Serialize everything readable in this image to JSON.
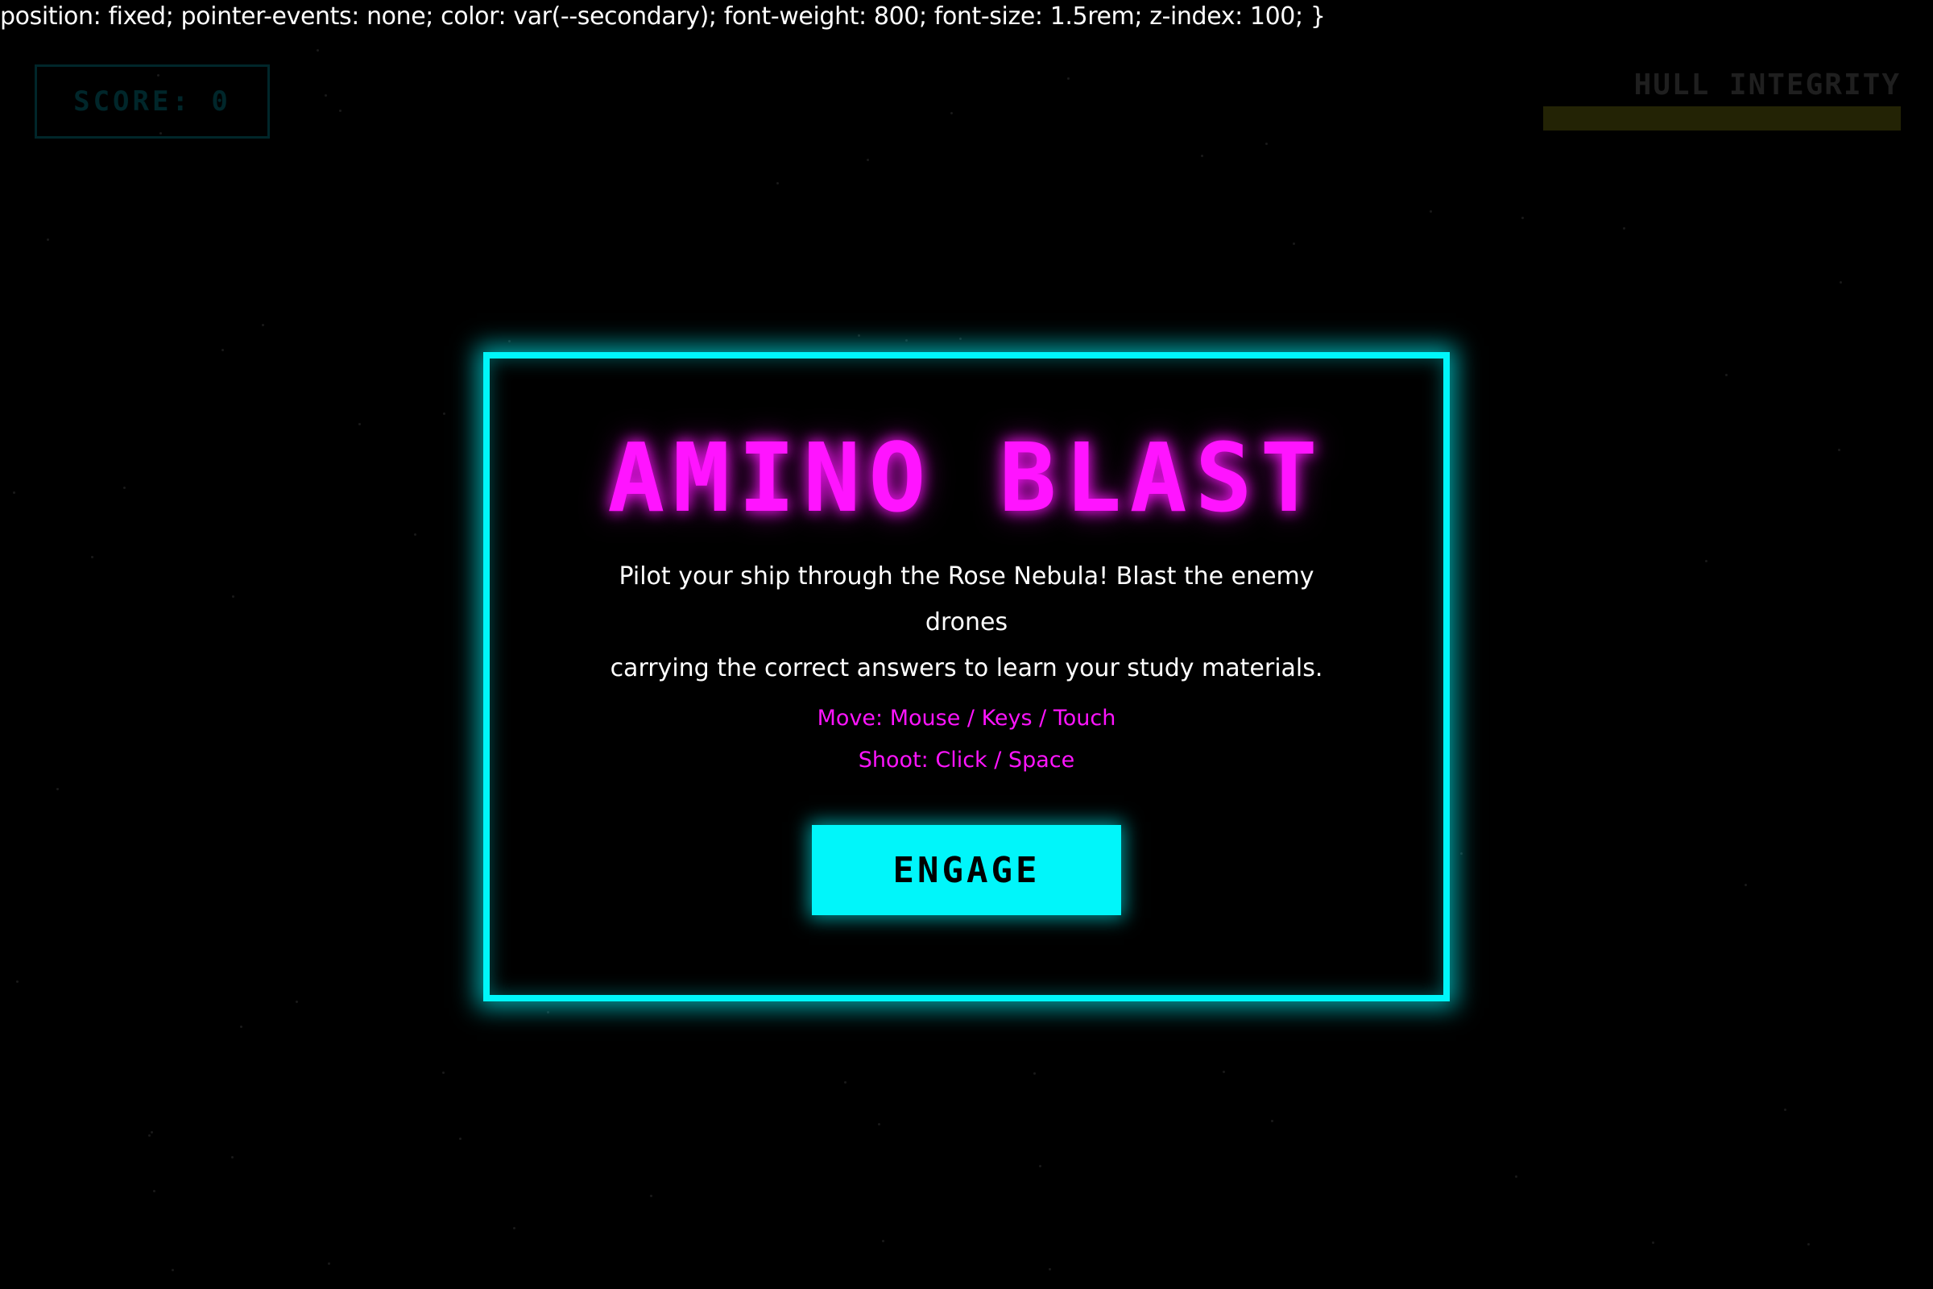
{
  "debug_css_text": "position: fixed; pointer-events: none; color: var(--secondary); font-weight: 800; font-size: 1.5rem; z-index: 100; }",
  "hud": {
    "score_label": "SCORE: 0",
    "hull_label": "HULL INTEGRITY",
    "hull_level_percent": 100
  },
  "modal": {
    "title": "AMINO BLAST",
    "description_line1": "Pilot your ship through the Rose Nebula! Blast the enemy drones",
    "description_line2": "carrying the correct answers to learn your study materials.",
    "controls_move": "Move: Mouse / Keys / Touch",
    "controls_shoot": "Shoot: Click / Space",
    "engage_label": "ENGAGE"
  },
  "colors": {
    "primary_cyan": "#00f6fa",
    "secondary_magenta": "#ff14ff",
    "background": "#000000"
  }
}
